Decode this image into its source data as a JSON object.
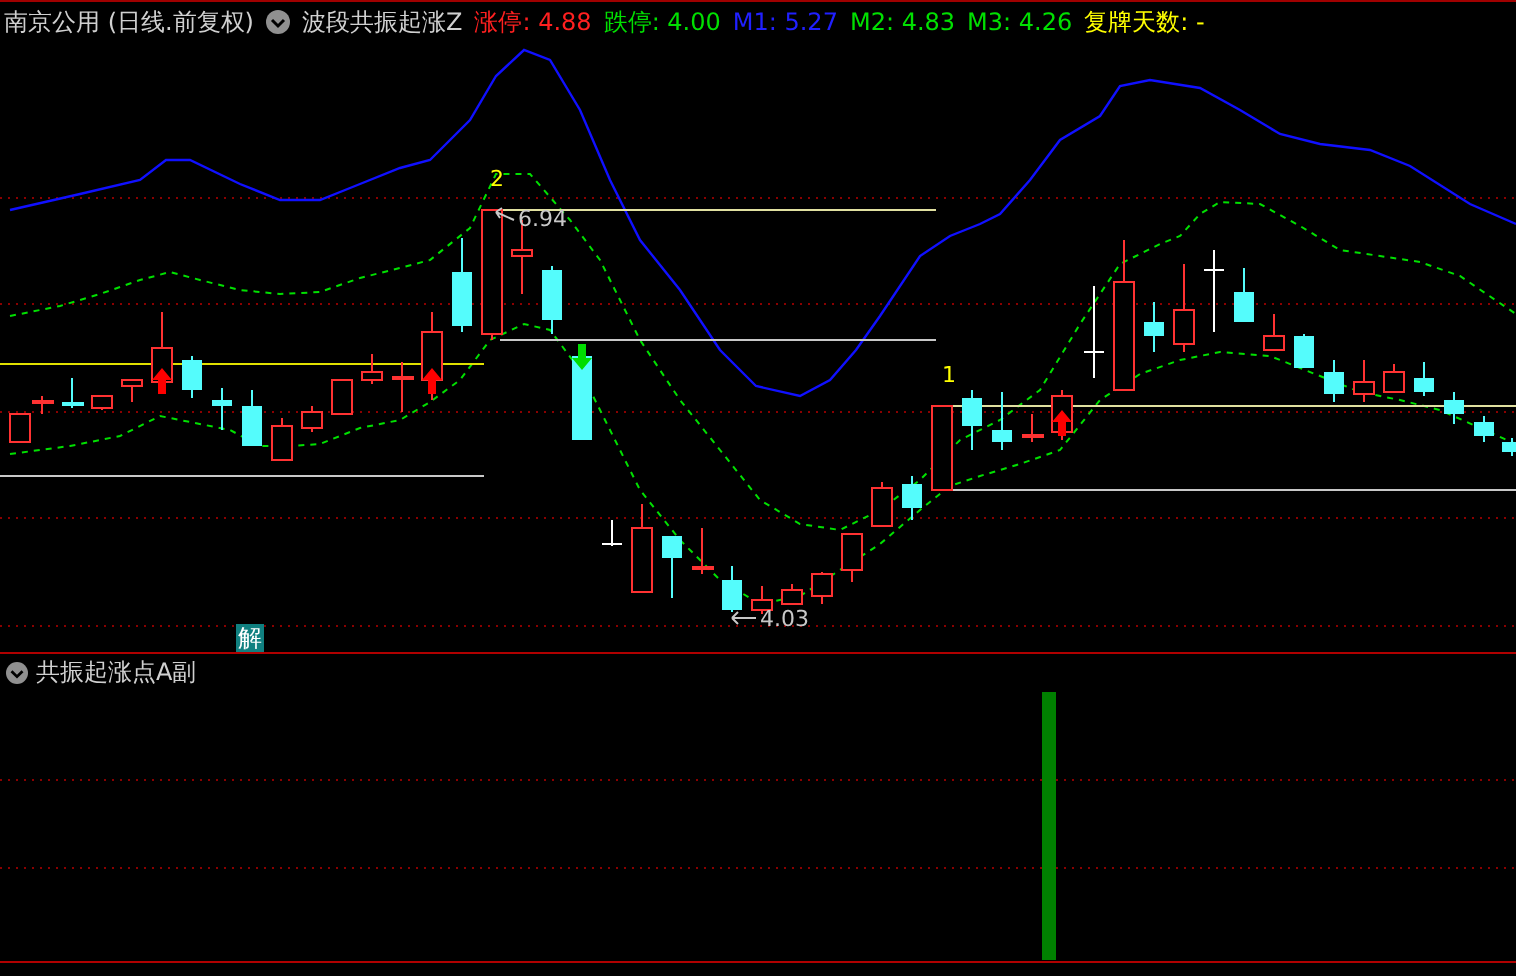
{
  "header": {
    "stock_title": "南京公用 (日线.前复权)",
    "indicator_name": "波段共振起涨Z",
    "values": [
      {
        "text": "涨停: 4.88",
        "color": "#ff2020"
      },
      {
        "text": "跌停: 4.00",
        "color": "#00e000"
      },
      {
        "text": "M1: 5.27",
        "color": "#2020ff"
      },
      {
        "text": "M2: 4.83",
        "color": "#00e000"
      },
      {
        "text": "M3: 4.26",
        "color": "#00e000"
      },
      {
        "text": "复牌天数: -",
        "color": "#ffff00"
      }
    ]
  },
  "main_chart": {
    "markers": [
      {
        "kind": "number",
        "text": "2"
      },
      {
        "kind": "price",
        "text": "6.94"
      },
      {
        "kind": "number",
        "text": "1"
      },
      {
        "kind": "price",
        "text": "4.03"
      }
    ],
    "badge": "解"
  },
  "sub_panel": {
    "title": "共振起涨点A副"
  }
}
